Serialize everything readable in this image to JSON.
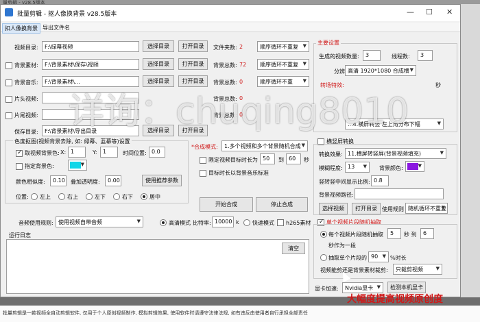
{
  "background_title": "量剪辑 - v28.5版本",
  "window": {
    "title": "批量剪辑 - 抠人像换背景 v28.5版本",
    "min": "—",
    "max": "☐",
    "close": "✕"
  },
  "menu": [
    "扣人像换背景",
    "导出文件名"
  ],
  "rows": {
    "video_dir": {
      "label": "视频目录:",
      "value": "F:\\绿幕视频",
      "btn1": "选择目录",
      "btn2": "打开目录",
      "info_label": "文件夹数:",
      "info_value": "2",
      "select": "顺序循环不重复"
    },
    "bg_dir": {
      "label": "背景素材:",
      "value": "F:\\背景素材\\保存\\视频",
      "btn1": "选择目录",
      "btn2": "打开目录",
      "info_label": "背景总数:",
      "info_value": "72",
      "select": "顺序循环不重复"
    },
    "bg_music": {
      "label": "背景音乐:",
      "value": "F:\\背景素材\\...",
      "btn1": "选择目录",
      "btn2": "打开目录",
      "info_label": "背景总数:",
      "info_value": "0",
      "select": "顺序循环不重"
    },
    "head_video": {
      "label": "片头视频:",
      "info_label": "背景总数:",
      "info_value": "0"
    },
    "tail_video": {
      "label": "片尾视频:",
      "info_label": "背景总数:",
      "info_value": "0"
    },
    "save_dir": {
      "label": "保存目录:",
      "value": "F:\\背景素材\\导出目录",
      "btn1": "选择目录",
      "btn2": "打开目录"
    }
  },
  "keying": {
    "group_label": "色度抠图(视频背景去除, 如: 绿幕、蓝幕等)设置",
    "take_color_label": "取视频背景色:",
    "x_label": "X:",
    "x_value": "1",
    "y_label": "Y:",
    "y_value": "1",
    "time_label": "时间位置:",
    "time_value": "0.0",
    "specify_color_label": "指定背景色:",
    "color_sim_label": "颜色相似度:",
    "color_sim_value": "0.10",
    "blend_label": "叠加透明度:",
    "blend_value": "0.00",
    "tutorial_btn": "使用推荐参数",
    "position_label": "位置:",
    "positions": [
      "左上",
      "右上",
      "左下",
      "右下",
      "居中"
    ]
  },
  "compose": {
    "mode_label": "*合成模式:",
    "mode_value": "1.多个视频和多个背景随机合成",
    "limit_label": "限定视频目标时长为",
    "limit_from": "50",
    "limit_to_label": "到",
    "limit_to": "60",
    "limit_unit": "秒",
    "target_bg_label": "目标时长以背景音乐标准",
    "start_btn": "开始合成",
    "stop_btn": "停止合成"
  },
  "audio": {
    "label": "音频使用规则:",
    "value": "使用视频自带音频",
    "hq_label": "高清模式",
    "bitrate_label": "比特率:",
    "bitrate_value": "10000",
    "bitrate_unit": "k",
    "fast_label": "快速模式",
    "h265_label": "h265素材"
  },
  "log": {
    "label": "运行日志",
    "clear_btn": "清空"
  },
  "main_settings": {
    "title": "主要设置",
    "count_label": "生成的视频数量:",
    "count_value": "3",
    "threads_label": "线程数:",
    "threads_value": "3",
    "resolution_label": "分辨率:",
    "resolution_value": "高清 1920*1080 合成横",
    "effect_label": "转场特效:",
    "effect_value": "...4.横屏转竖 左上角分布下幅",
    "seconds_label": "秒"
  },
  "hv_convert": {
    "label": "横竖屏转换",
    "effect_label": "转换效果:",
    "effect_value": "11.横屏转竖屏(背景视频填充)",
    "blur_label": "模糊程度:",
    "blur_value": "13",
    "bgcolor_label": "背景颜色:",
    "ratio_label": "竖转竖中间显示比例:",
    "ratio_value": "0.8",
    "path_label": "背景视频路径:",
    "select_btn": "选择视频",
    "open_btn": "打开目录",
    "rule_label": "使用规则",
    "rule_value": "随机循环不重复"
  },
  "random_extract": {
    "label": "单个视频片段随机抽取",
    "each_label": "每个视频片段随机抽取",
    "each_from": "5",
    "each_to_label": "秒 到",
    "each_to": "6",
    "each_tail": "秒作为一段",
    "single_label": "抽取单个片段的",
    "single_value": "90",
    "single_tail": "%时长",
    "source_label": "视频能剪还是背景素材裁剪:",
    "source_value": "只裁剪视频"
  },
  "gpu": {
    "label": "显卡加速:",
    "value": "Nvidia显卡",
    "detect_btn": "检测本机显卡"
  },
  "colors": {
    "swatch_cyan": "#11d6e8",
    "swatch_purple": "#8a18e0",
    "accent_red": "#d01818"
  },
  "overlay": "详询：chuqing8010",
  "promo": "大幅度提高视频原创度",
  "footer_text": "批量剪辑是一款视频全自动剪辑软件, 仅用于个人原创视频制作, 模拟剪辑效果, 使用软件时请遵守法律法规, 如有违反由使用者自行承担全部责任"
}
